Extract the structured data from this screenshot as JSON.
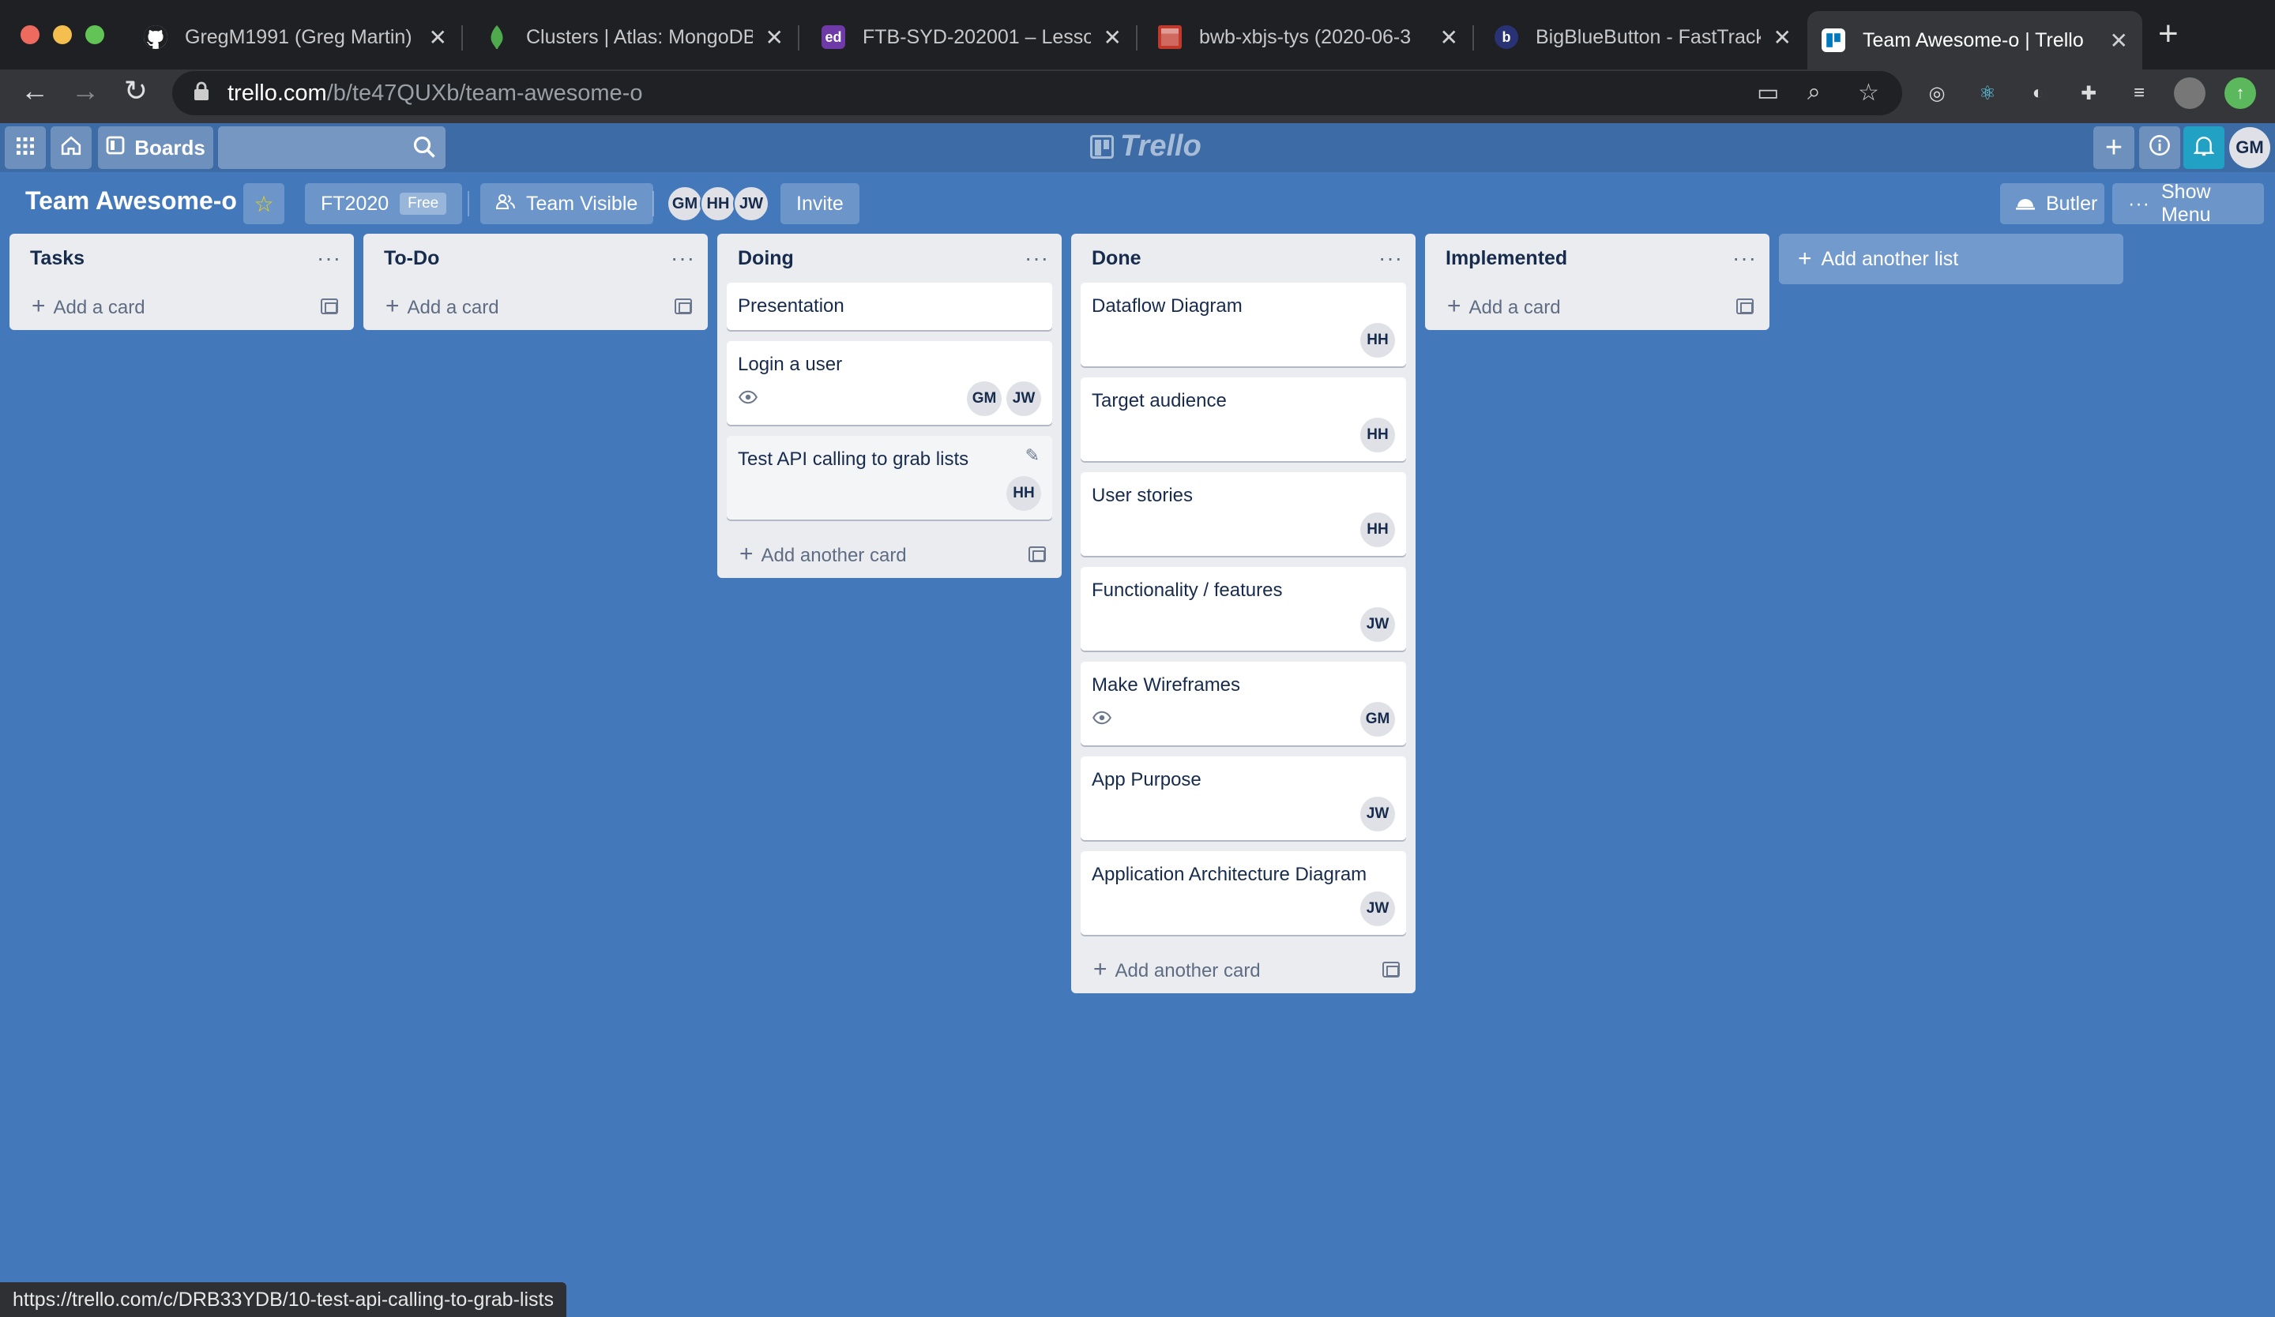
{
  "browser": {
    "tabs": [
      {
        "title": "GregM1991 (Greg Martin)",
        "icon": "github-icon"
      },
      {
        "title": "Clusters | Atlas: MongoDB",
        "icon": "mongodb-leaf-icon"
      },
      {
        "title": "FTB-SYD-202001 – Lesso",
        "icon": "ed-icon",
        "icon_text": "ed"
      },
      {
        "title": "bwb-xbjs-tys (2020-06-3",
        "icon": "clapperboard-icon"
      },
      {
        "title": "BigBlueButton - FastTrack",
        "icon": "bigbluebutton-icon",
        "icon_text": "b"
      },
      {
        "title": "Team Awesome-o | Trello",
        "icon": "trello-icon"
      }
    ],
    "url_host": "trello.com",
    "url_path": "/b/te47QUXb/team-awesome-o",
    "status_url": "https://trello.com/c/DRB33YDB/10-test-api-calling-to-grab-lists"
  },
  "trello_header": {
    "boards_label": "Boards",
    "logo_text": "Trello",
    "user_initials": "GM"
  },
  "board": {
    "title": "Team Awesome-o",
    "team_name": "FT2020",
    "team_badge": "Free",
    "visibility_label": "Team Visible",
    "members": [
      "GM",
      "HH",
      "JW"
    ],
    "invite_label": "Invite",
    "butler_label": "Butler",
    "show_menu_label": "Show Menu",
    "add_list_label": "Add another list"
  },
  "lists": [
    {
      "title": "Tasks",
      "cards": [],
      "add_label": "Add a card"
    },
    {
      "title": "To-Do",
      "cards": [],
      "add_label": "Add a card"
    },
    {
      "title": "Doing",
      "add_label": "Add another card",
      "cards": [
        {
          "title": "Presentation",
          "members": [],
          "watching": false
        },
        {
          "title": "Login a user",
          "members": [
            "GM",
            "JW"
          ],
          "watching": true
        },
        {
          "title": "Test API calling to grab lists",
          "members": [
            "HH"
          ],
          "watching": false,
          "hovered": true
        }
      ]
    },
    {
      "title": "Done",
      "add_label": "Add another card",
      "cards": [
        {
          "title": "Dataflow Diagram",
          "members": [
            "HH"
          ],
          "watching": false
        },
        {
          "title": "Target audience",
          "members": [
            "HH"
          ],
          "watching": false
        },
        {
          "title": "User stories",
          "members": [
            "HH"
          ],
          "watching": false
        },
        {
          "title": "Functionality / features",
          "members": [
            "JW"
          ],
          "watching": false
        },
        {
          "title": "Make Wireframes",
          "members": [
            "GM"
          ],
          "watching": true
        },
        {
          "title": "App Purpose",
          "members": [
            "JW"
          ],
          "watching": false
        },
        {
          "title": "Application Architecture Diagram",
          "members": [
            "JW"
          ],
          "watching": false
        }
      ]
    },
    {
      "title": "Implemented",
      "cards": [],
      "add_label": "Add a card"
    }
  ],
  "colors": {
    "board_bg": "#4378bb",
    "list_bg": "#ebecf0",
    "card_bg": "#ffffff"
  }
}
